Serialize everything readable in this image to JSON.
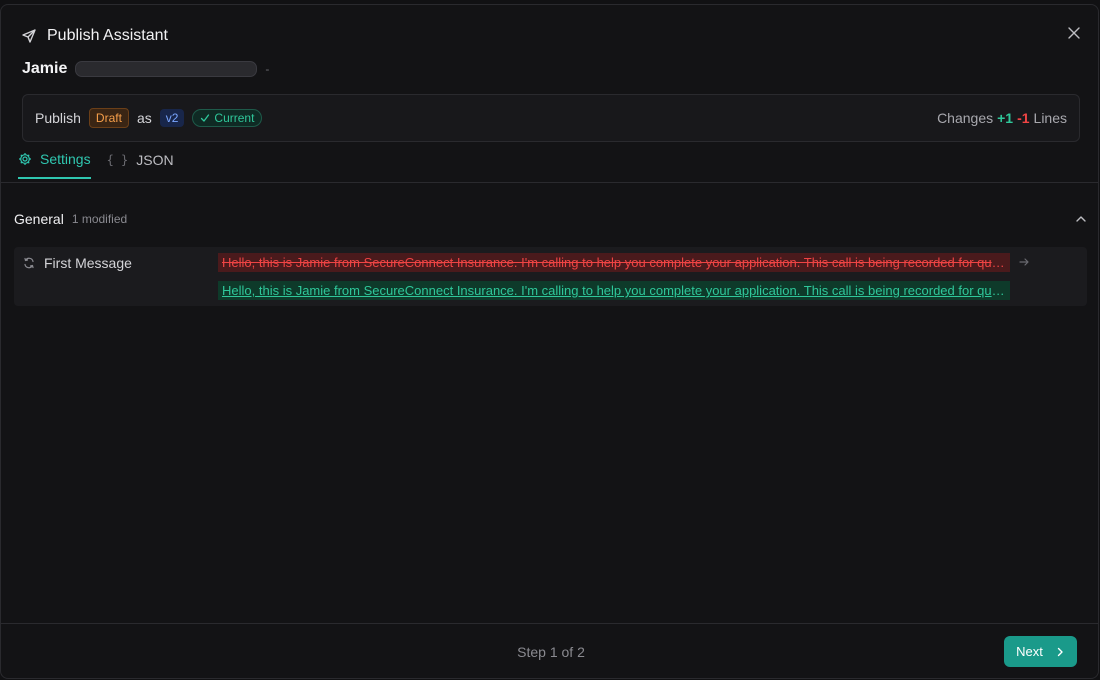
{
  "dialog": {
    "title": "Publish Assistant",
    "assistant_name": "Jamie",
    "separator": "-"
  },
  "publish_bar": {
    "publish_label": "Publish",
    "source_badge": "Draft",
    "as_label": "as",
    "version_badge": "v2",
    "current_badge": "Current",
    "changes_label": "Changes",
    "added": "+1",
    "removed": "-1",
    "lines_label": "Lines"
  },
  "tabs": [
    {
      "label": "Settings",
      "active": true,
      "icon": "gear-icon"
    },
    {
      "label": "JSON",
      "active": false,
      "icon": "braces-icon"
    }
  ],
  "section": {
    "title": "General",
    "meta": "1 modified"
  },
  "diff": {
    "field_label": "First Message",
    "old_value": "Hello, this is Jamie from SecureConnect Insurance. I'm calling to help you complete your application. This call is being recorded for quality and compliance purposes.",
    "new_value": "Hello, this is Jamie from SecureConnect Insurance. I'm calling to help you complete your application. This call is being recorded for quality assurance purposes."
  },
  "footer": {
    "step_text": "Step 1 of 2",
    "next_label": "Next"
  },
  "colors": {
    "accent": "#1a9a8a",
    "added": "#2fc79a",
    "removed": "#ef4444",
    "draft": "#f59e4a"
  }
}
